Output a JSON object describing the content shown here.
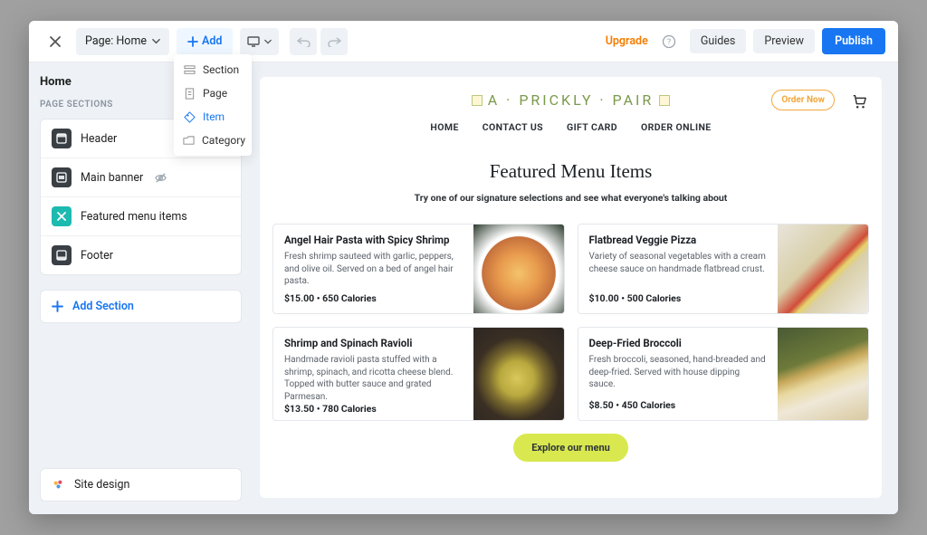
{
  "topbar": {
    "page_selector": "Page: Home",
    "add_label": "Add",
    "upgrade": "Upgrade",
    "guides": "Guides",
    "preview": "Preview",
    "publish": "Publish"
  },
  "add_menu": {
    "items": [
      {
        "label": "Section",
        "icon": "section"
      },
      {
        "label": "Page",
        "icon": "page"
      },
      {
        "label": "Item",
        "icon": "item",
        "active": true
      },
      {
        "label": "Category",
        "icon": "folder"
      }
    ]
  },
  "sidebar": {
    "title": "Home",
    "page_sections_label": "PAGE SECTIONS",
    "sections": [
      {
        "label": "Header",
        "icon": "header"
      },
      {
        "label": "Main banner",
        "icon": "banner",
        "hidden": true
      },
      {
        "label": "Featured menu items",
        "icon": "featured"
      },
      {
        "label": "Footer",
        "icon": "footer"
      }
    ],
    "add_section": "Add Section",
    "site_design": "Site design"
  },
  "site": {
    "logo": "A · PRICKLY · PAIR",
    "order_now": "Order Now",
    "nav": [
      "HOME",
      "CONTACT US",
      "GIFT CARD",
      "ORDER ONLINE"
    ],
    "featured_title": "Featured Menu Items",
    "featured_sub": "Try one of our signature selections and see what everyone's talking about",
    "items": [
      {
        "title": "Angel Hair Pasta with Spicy Shrimp",
        "desc": "Fresh shrimp sauteed with garlic, peppers, and olive oil. Served on a bed of angel hair pasta.",
        "price_calories": "$15.00  •  650 Calories"
      },
      {
        "title": "Flatbread Veggie Pizza",
        "desc": "Variety of seasonal vegetables with a cream cheese sauce on handmade flatbread crust.",
        "price_calories": "$10.00  •  500 Calories"
      },
      {
        "title": "Shrimp and Spinach Ravioli",
        "desc": "Handmade ravioli pasta stuffed with a shrimp, spinach, and ricotta cheese blend. Topped with butter sauce and grated Parmesan.",
        "price_calories": "$13.50  •  780 Calories"
      },
      {
        "title": "Deep-Fried Broccoli",
        "desc": "Fresh broccoli, seasoned, hand-breaded and deep-fried. Served with house dipping sauce.",
        "price_calories": "$8.50  •  450 Calories"
      }
    ],
    "explore": "Explore our menu"
  }
}
